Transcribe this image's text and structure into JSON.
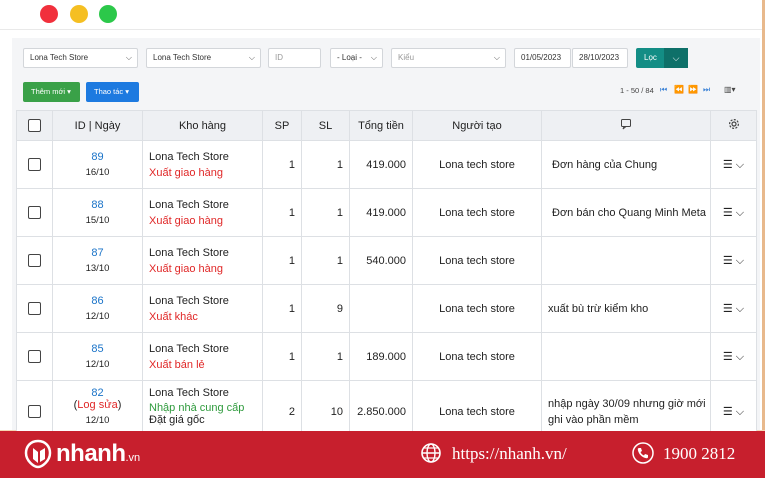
{
  "filters": {
    "store1": "Lona Tech Store",
    "store2": "Lona Tech Store",
    "id_placeholder": "ID",
    "loai": "- Loại -",
    "kieu_placeholder": "Kiểu",
    "date_from": "01/05/2023",
    "date_to": "28/10/2023",
    "filter_button": "Lọc"
  },
  "toolbar": {
    "add_new": "Thêm mới",
    "actions": "Thao tác",
    "pagination": "1 - 50 / 84"
  },
  "table": {
    "headers": [
      "ID | Ngày",
      "Kho hàng",
      "SP",
      "SL",
      "Tổng tiền",
      "Người tạo"
    ],
    "rows": [
      {
        "id": "89",
        "date": "16/10",
        "store": "Lona Tech Store",
        "type": "Xuất giao hàng",
        "sp": "1",
        "sl": "1",
        "total": "419.000",
        "creator": "Lona tech store",
        "note": "Đơn hàng của Chung"
      },
      {
        "id": "88",
        "date": "15/10",
        "store": "Lona Tech Store",
        "type": "Xuất giao hàng",
        "sp": "1",
        "sl": "1",
        "total": "419.000",
        "creator": "Lona tech store",
        "note": "Đơn bán cho Quang Minh Meta"
      },
      {
        "id": "87",
        "date": "13/10",
        "store": "Lona Tech Store",
        "type": "Xuất giao hàng",
        "sp": "1",
        "sl": "1",
        "total": "540.000",
        "creator": "Lona tech store",
        "note": ""
      },
      {
        "id": "86",
        "date": "12/10",
        "store": "Lona Tech Store",
        "type": "Xuất khác",
        "sp": "1",
        "sl": "9",
        "total": "",
        "creator": "Lona tech store",
        "note": "xuất bù trừ kiểm kho"
      },
      {
        "id": "85",
        "date": "12/10",
        "store": "Lona Tech Store",
        "type": "Xuất bán lẻ",
        "sp": "1",
        "sl": "1",
        "total": "189.000",
        "creator": "Lona tech store",
        "note": ""
      },
      {
        "id": "82",
        "log": "Log sửa",
        "date": "12/10",
        "store": "Lona Tech Store",
        "type": "Nhập nhà cung cấp",
        "type2": "Đặt giá gốc",
        "sp": "2",
        "sl": "10",
        "total": "2.850.000",
        "creator": "Lona tech store",
        "note": "nhập ngày 30/09 nhưng giờ mới ghi vào phần mềm"
      }
    ]
  },
  "footer": {
    "brand": "nhanh",
    "brand_suffix": ".vn",
    "url": "https://nhanh.vn/",
    "phone": "1900 2812"
  },
  "colors": {
    "accent": "#138d85",
    "brand_red": "#c71f2d",
    "link": "#1a73c8",
    "red_text": "#e02727",
    "green_text": "#2e9a3c"
  },
  "icons": [
    "comment-icon",
    "settings-icon",
    "menu-icon",
    "chevron-down-icon",
    "globe-icon",
    "phone-icon"
  ]
}
